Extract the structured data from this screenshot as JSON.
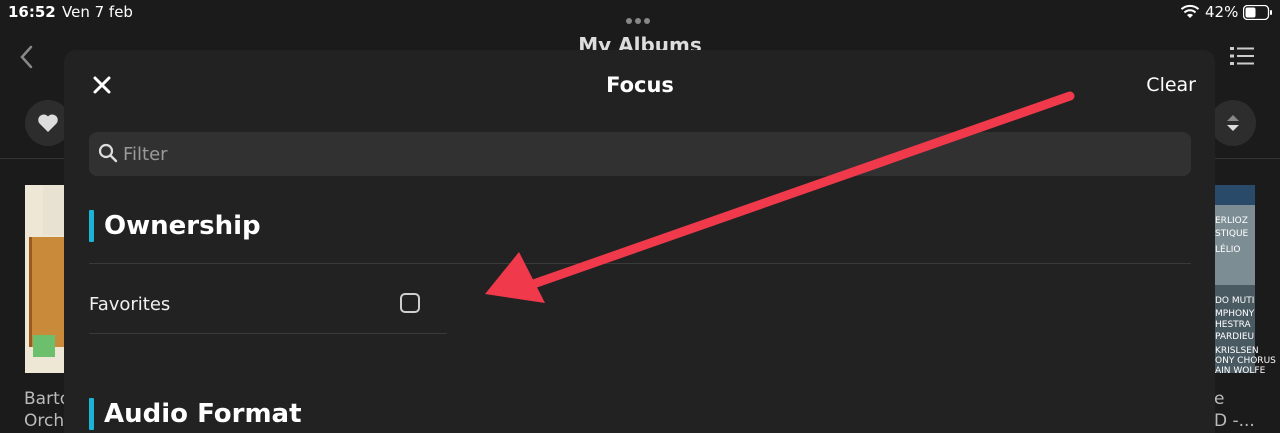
{
  "status_bar": {
    "time": "16:52",
    "date": "Ven 7 feb",
    "battery": "42%"
  },
  "background": {
    "title": "My Albums",
    "album_left_lines": [
      "Bartó",
      "Orch"
    ],
    "album_right_lines": [
      "e",
      "D -..."
    ],
    "album_right_cover": [
      "ERLIOZ",
      "STIQUE",
      "LÉLIO",
      "DO MUTI",
      "MPHONY",
      "HESTRA",
      "PARDIEU",
      "KRISLSEN",
      "ONY CHORUS",
      "AIN WOLFE"
    ]
  },
  "modal": {
    "title": "Focus",
    "clear_label": "Clear",
    "filter_placeholder": "Filter",
    "sections": [
      {
        "title": "Ownership",
        "items": [
          {
            "label": "Favorites",
            "checked": false
          }
        ]
      },
      {
        "title": "Audio Format"
      }
    ]
  },
  "annotation": {
    "arrow_color": "#f0394b"
  },
  "colors": {
    "accent": "#1ab5d6",
    "background": "#1b1b1b",
    "modal": "#222223"
  }
}
